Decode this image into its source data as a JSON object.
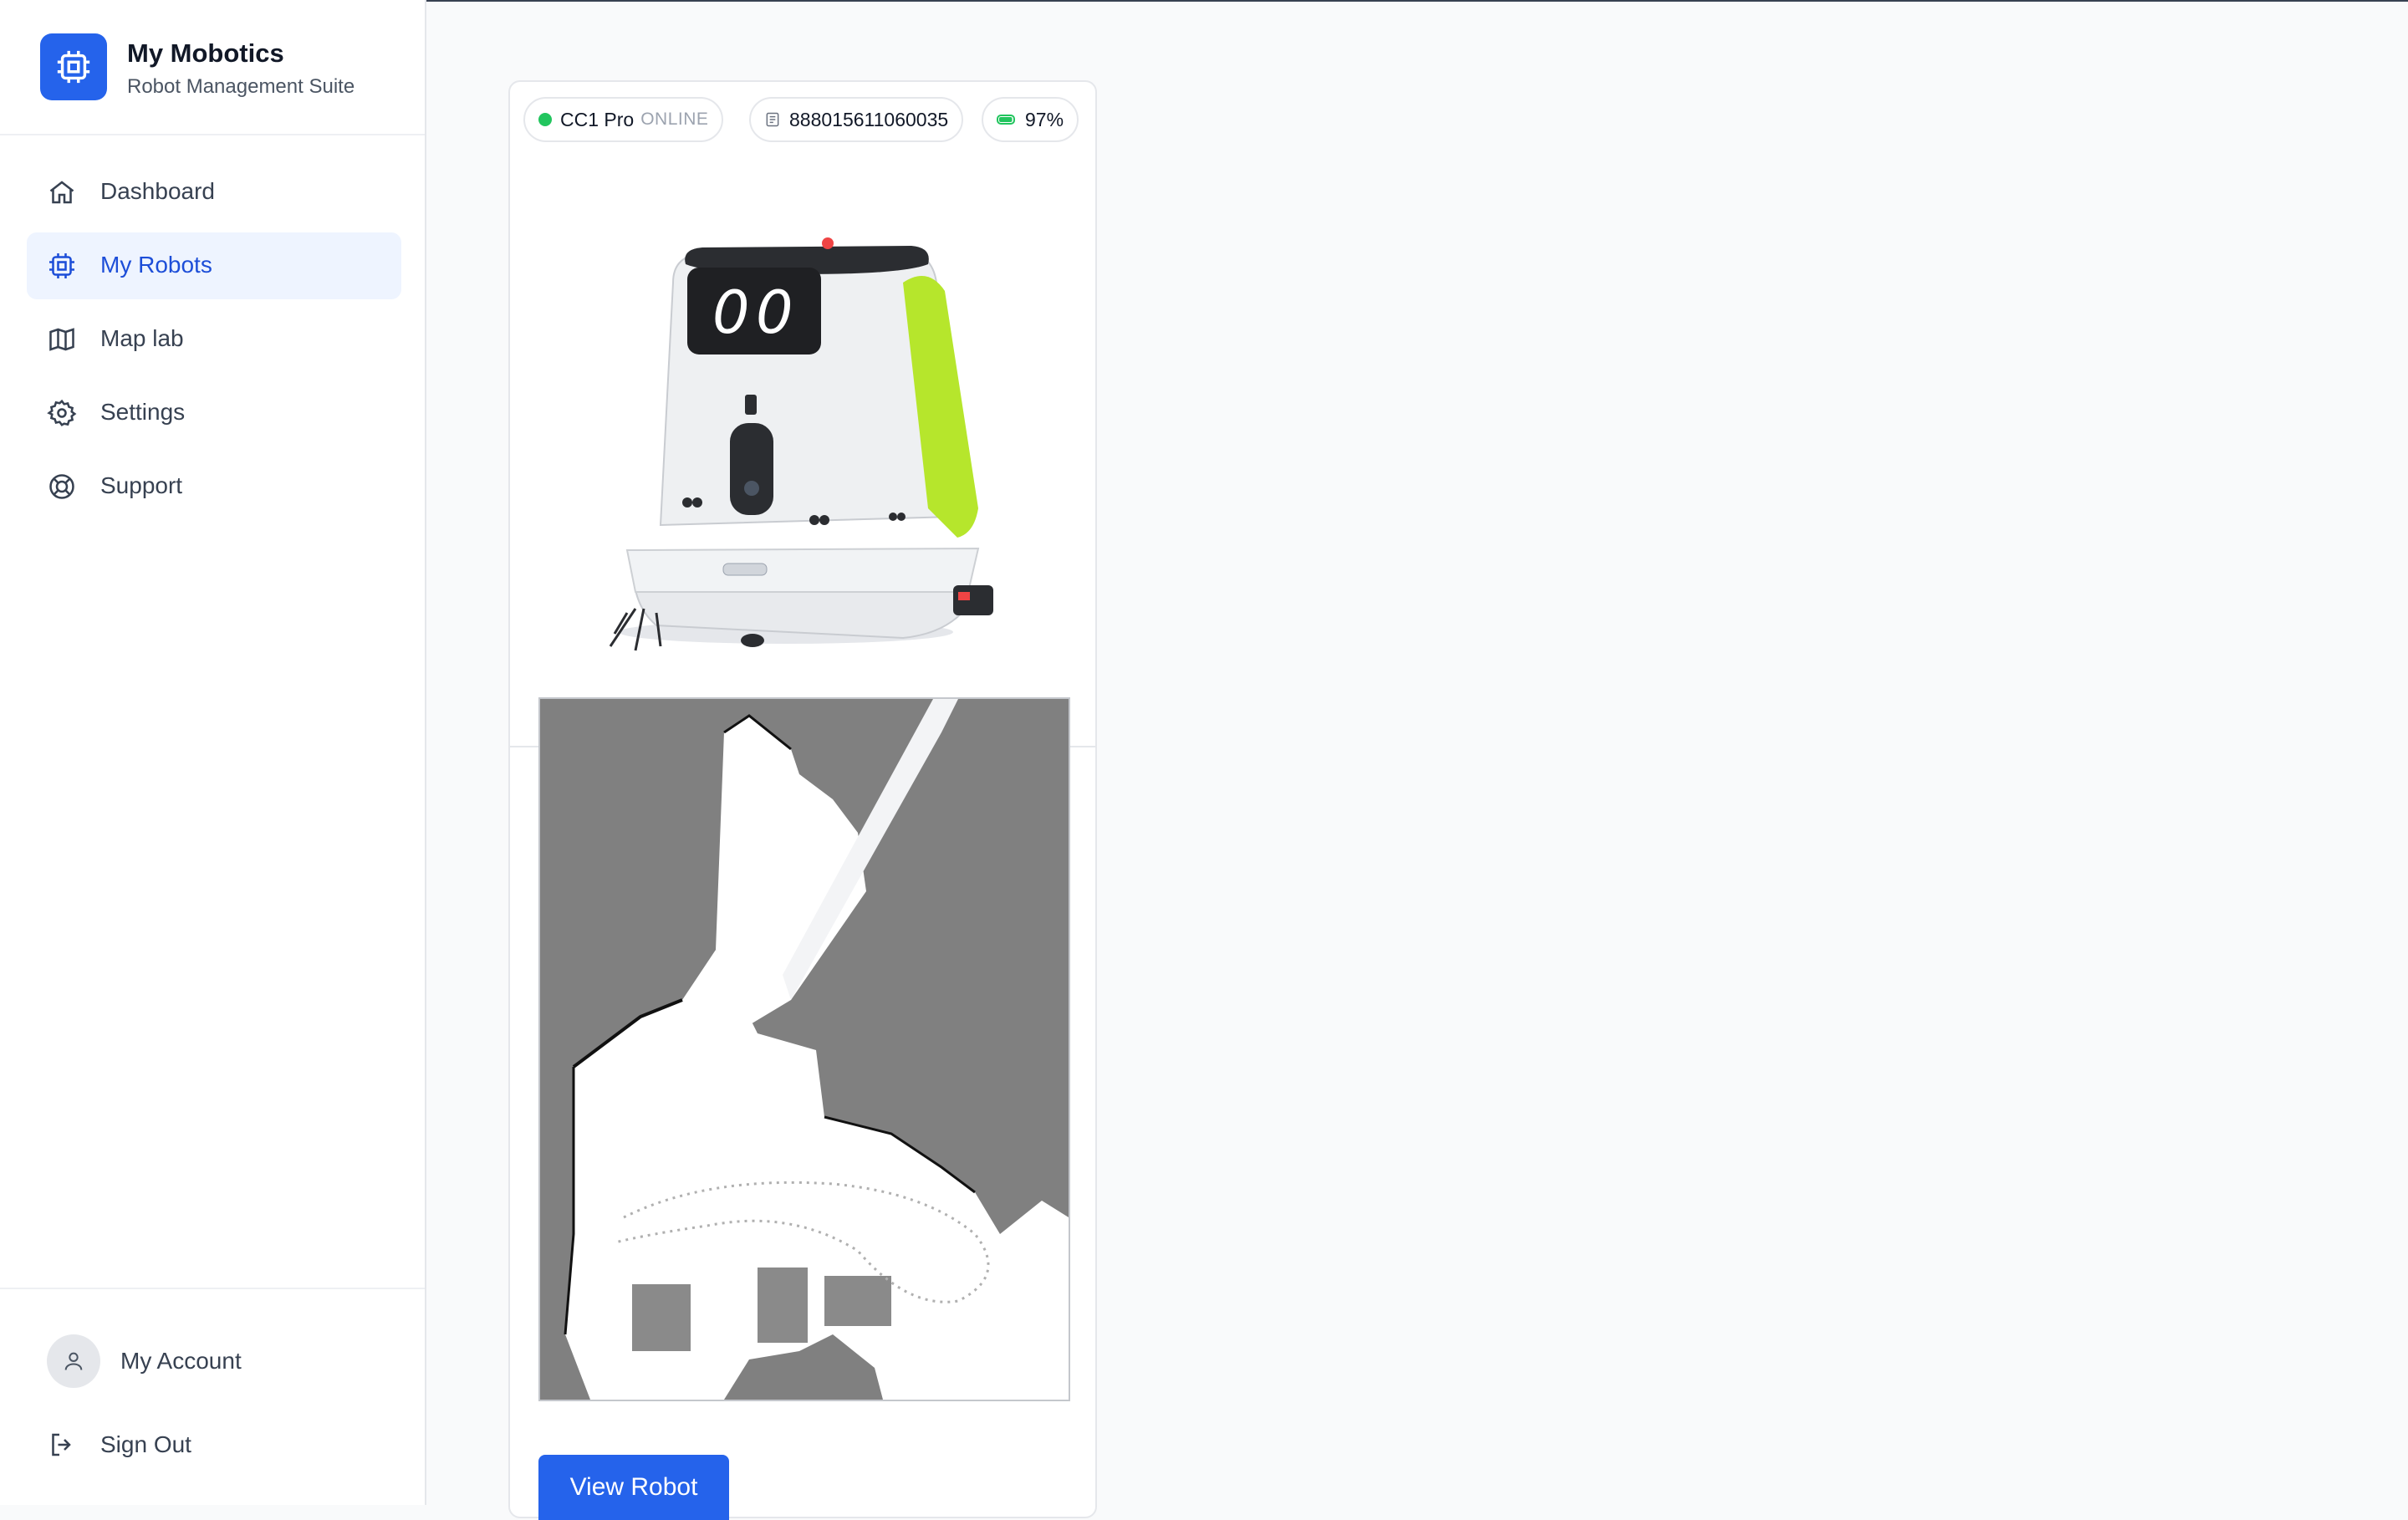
{
  "app": {
    "title": "My Mobotics",
    "subtitle": "Robot Management Suite"
  },
  "sidebar": {
    "items": [
      {
        "label": "Dashboard",
        "icon": "home-icon",
        "active": false
      },
      {
        "label": "My Robots",
        "icon": "chip-icon",
        "active": true
      },
      {
        "label": "Map lab",
        "icon": "map-icon",
        "active": false
      },
      {
        "label": "Settings",
        "icon": "gear-icon",
        "active": false
      },
      {
        "label": "Support",
        "icon": "lifebuoy-icon",
        "active": false
      }
    ],
    "footer": {
      "account_label": "My Account",
      "signout_label": "Sign Out"
    }
  },
  "robot_card": {
    "model": "CC1 Pro",
    "status": "ONLINE",
    "serial": "888015611060035",
    "battery": "97%",
    "battery_level": 0.97,
    "view_button_label": "View Robot"
  },
  "colors": {
    "accent": "#2563eb",
    "online": "#22c55e",
    "robot_lime": "#b6e62c"
  }
}
